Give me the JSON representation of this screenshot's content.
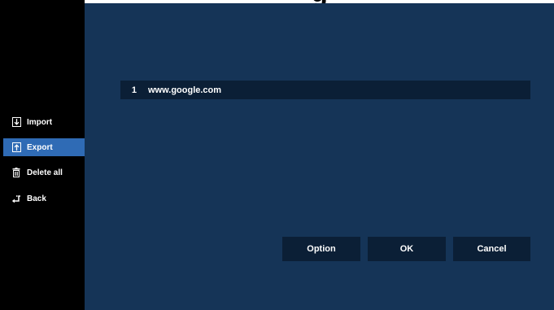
{
  "sidebar": {
    "items": [
      {
        "label": "Import",
        "icon": "import-icon",
        "active": false
      },
      {
        "label": "Export",
        "icon": "export-icon",
        "active": true
      },
      {
        "label": "Delete all",
        "icon": "trash-icon",
        "active": false
      },
      {
        "label": "Back",
        "icon": "back-arrow-icon",
        "active": false
      }
    ]
  },
  "list": {
    "rows": [
      {
        "index": "1",
        "url": "www.google.com"
      }
    ]
  },
  "buttons": {
    "option": "Option",
    "ok": "OK",
    "cancel": "Cancel"
  },
  "colors": {
    "background": "#153457",
    "sidebar": "#000000",
    "selected": "#2f6bb5",
    "field": "#0b1f36"
  }
}
